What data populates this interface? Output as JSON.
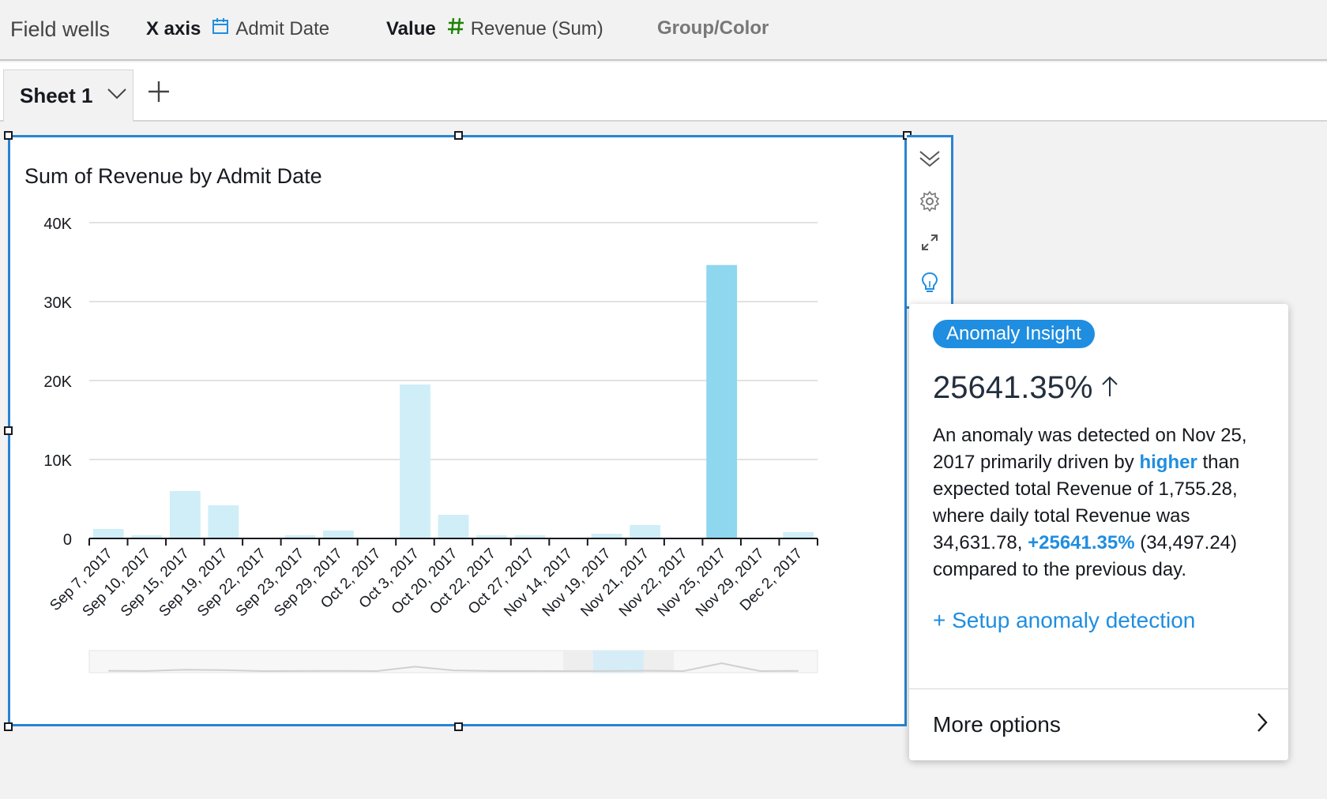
{
  "field_wells": {
    "title": "Field wells",
    "x_axis": {
      "label": "X axis",
      "icon": "calendar-icon",
      "value": "Admit Date"
    },
    "value": {
      "label": "Value",
      "icon": "hash-icon",
      "value": "Revenue (Sum)"
    },
    "group_color": {
      "label": "Group/Color"
    }
  },
  "tabs": {
    "sheet_label": "Sheet 1"
  },
  "colors": {
    "accent": "#2a84d2",
    "bar": "#cfeef8",
    "bar_highlight": "#8fd6ef",
    "insight_blue": "#1f8ee0"
  },
  "chart_data": {
    "type": "bar",
    "title": "Sum of Revenue by Admit Date",
    "xlabel": "",
    "ylabel": "",
    "ylim": [
      0,
      40000
    ],
    "yticks": [
      "0",
      "10K",
      "20K",
      "30K",
      "40K"
    ],
    "yticks_values": [
      0,
      10000,
      20000,
      30000,
      40000
    ],
    "categories": [
      "Sep 7, 2017",
      "Sep 10, 2017",
      "Sep 15, 2017",
      "Sep 19, 2017",
      "Sep 22, 2017",
      "Sep 23, 2017",
      "Sep 29, 2017",
      "Oct 2, 2017",
      "Oct 3, 2017",
      "Oct 20, 2017",
      "Oct 22, 2017",
      "Oct 27, 2017",
      "Nov 14, 2017",
      "Nov 19, 2017",
      "Nov 21, 2017",
      "Nov 22, 2017",
      "Nov 25, 2017",
      "Nov 29, 2017",
      "Dec 2, 2017"
    ],
    "values": [
      1200,
      400,
      6000,
      4200,
      100,
      400,
      1000,
      100,
      19500,
      3000,
      400,
      400,
      100,
      600,
      1700,
      100,
      34631.78,
      100,
      800
    ],
    "highlight_index": 16,
    "grid": true
  },
  "insight": {
    "badge": "Anomaly Insight",
    "percent": "25641.35%",
    "desc_1": "An anomaly was detected on Nov 25, 2017 primarily driven by ",
    "desc_higher": "higher",
    "desc_2": " than expected total Revenue of 1,755.28, where daily total Revenue was 34,631.78, ",
    "desc_change": "+25641.35%",
    "desc_3": " (34,497.24) compared to the previous day.",
    "setup_link": "+ Setup anomaly detection",
    "more_options": "More options"
  }
}
